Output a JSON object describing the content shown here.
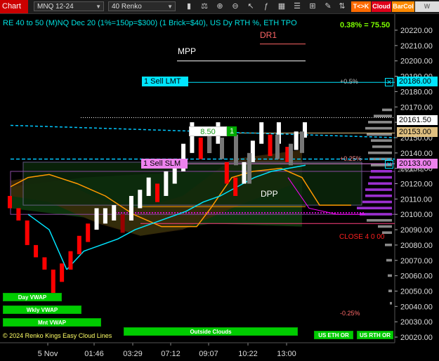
{
  "toolbar": {
    "chart_label": "Chart",
    "instrument": "MNQ 12-24",
    "bar_type": "40 Renko",
    "btn_tk": "T<>K",
    "btn_cloud": "Cloud",
    "btn_barcol": "BarCol",
    "btn_w": "W VWAP"
  },
  "header": {
    "title": "RE 40 to 50 (M)NQ Dec 20 (1%=150p=$300) (1 Brick=$40), US Dy RTH %, ETH TPO",
    "pct_change": "0.38% = 75.50"
  },
  "orders": {
    "sell_lmt": "1 Sell LMT",
    "sell_slm": "1 Sell SLM",
    "qty_price": "8.50",
    "qty": "1"
  },
  "levels": {
    "dr1": "DR1",
    "mpp": "MPP",
    "dpp": "DPP",
    "plus05": "+0.5%",
    "plus025": "+0.25%",
    "minus025": "-0.25%",
    "close": "CLOSE 4 0 00"
  },
  "price_labels": {
    "lmt": "20186.00",
    "last": "20161.50",
    "tan": "20153.00",
    "slm": "20133.00",
    "partial": "20129.72"
  },
  "buttons": {
    "day_vwap": "Day VWAP",
    "wkly_vwap": "Wkly VWAP",
    "mnt_vwap": "Mnt VWAP",
    "outside_clouds": "Outside Clouds",
    "us_eth_or": "US ETH OR",
    "us_rth_or": "US RTH OR"
  },
  "watermark": "© 2024 Renko Kings Easy Cloud Lines",
  "chart_data": {
    "type": "renko",
    "y_ticks": [
      20220,
      20210,
      20200,
      20190,
      20180,
      20170,
      20160,
      20150,
      20140,
      20130,
      20120,
      20110,
      20100,
      20090,
      20080,
      20070,
      20060,
      20050,
      20040,
      20030,
      20020
    ],
    "y_range": [
      20016,
      20228
    ],
    "x_labels": [
      "5 Nov",
      "01:46",
      "03:29",
      "07:12",
      "09:07",
      "10:22",
      "13:00"
    ],
    "bricks": [
      {
        "c": "down",
        "lo": 20104,
        "hi": 20112
      },
      {
        "c": "down",
        "lo": 20096,
        "hi": 20104
      },
      {
        "c": "down",
        "lo": 20080,
        "hi": 20096
      },
      {
        "c": "down",
        "lo": 20072,
        "hi": 20080
      },
      {
        "c": "down",
        "lo": 20064,
        "hi": 20072
      },
      {
        "c": "down",
        "lo": 20048,
        "hi": 20064
      },
      {
        "c": "down",
        "lo": 20056,
        "hi": 20068
      },
      {
        "c": "down",
        "lo": 20064,
        "hi": 20076
      },
      {
        "c": "down",
        "lo": 20074,
        "hi": 20086
      },
      {
        "c": "down",
        "lo": 20082,
        "hi": 20094
      },
      {
        "c": "up",
        "lo": 20090,
        "hi": 20104
      },
      {
        "c": "up",
        "lo": 20094,
        "hi": 20104
      },
      {
        "c": "up",
        "lo": 20096,
        "hi": 20106
      },
      {
        "c": "down",
        "lo": 20088,
        "hi": 20100
      },
      {
        "c": "up",
        "lo": 20096,
        "hi": 20112
      },
      {
        "c": "up",
        "lo": 20104,
        "hi": 20116
      },
      {
        "c": "up",
        "lo": 20112,
        "hi": 20124
      },
      {
        "c": "down",
        "lo": 20108,
        "hi": 20120
      },
      {
        "c": "up",
        "lo": 20112,
        "hi": 20128
      },
      {
        "c": "up",
        "lo": 20120,
        "hi": 20136
      },
      {
        "c": "up",
        "lo": 20128,
        "hi": 20146
      },
      {
        "c": "up",
        "lo": 20140,
        "hi": 20160
      },
      {
        "c": "down",
        "lo": 20136,
        "hi": 20150
      },
      {
        "c": "up",
        "lo": 20140,
        "hi": 20154
      },
      {
        "c": "up",
        "lo": 20146,
        "hi": 20160
      },
      {
        "c": "down",
        "lo": 20120,
        "hi": 20134
      },
      {
        "c": "down",
        "lo": 20112,
        "hi": 20124
      },
      {
        "c": "up",
        "lo": 20120,
        "hi": 20134
      },
      {
        "c": "up",
        "lo": 20134,
        "hi": 20148
      },
      {
        "c": "up",
        "lo": 20146,
        "hi": 20160
      },
      {
        "c": "down",
        "lo": 20138,
        "hi": 20152
      },
      {
        "c": "up",
        "lo": 20146,
        "hi": 20160
      },
      {
        "c": "down",
        "lo": 20134,
        "hi": 20144
      },
      {
        "c": "up",
        "lo": 20142,
        "hi": 20154
      },
      {
        "c": "up",
        "lo": 20150,
        "hi": 20160
      }
    ],
    "volume_profile": [
      {
        "p": 20168,
        "w": 14,
        "col": "gray"
      },
      {
        "p": 20164,
        "w": 26,
        "col": "gray"
      },
      {
        "p": 20160,
        "w": 34,
        "col": "gray"
      },
      {
        "p": 20156,
        "w": 38,
        "col": "gray"
      },
      {
        "p": 20152,
        "w": 36,
        "col": "gray"
      },
      {
        "p": 20148,
        "w": 30,
        "col": "gray"
      },
      {
        "p": 20144,
        "w": 28,
        "col": "gray"
      },
      {
        "p": 20140,
        "w": 34,
        "col": "gray"
      },
      {
        "p": 20136,
        "w": 32,
        "col": "gray"
      },
      {
        "p": 20132,
        "w": 30,
        "col": "gray"
      },
      {
        "p": 20128,
        "w": 30,
        "col": "purple"
      },
      {
        "p": 20124,
        "w": 32,
        "col": "purple"
      },
      {
        "p": 20120,
        "w": 34,
        "col": "purple"
      },
      {
        "p": 20116,
        "w": 38,
        "col": "purple"
      },
      {
        "p": 20112,
        "w": 38,
        "col": "purple"
      },
      {
        "p": 20108,
        "w": 42,
        "col": "purple"
      },
      {
        "p": 20104,
        "w": 50,
        "col": "purple"
      },
      {
        "p": 20100,
        "w": 46,
        "col": "purple"
      },
      {
        "p": 20096,
        "w": 36,
        "col": "gray"
      },
      {
        "p": 20092,
        "w": 20,
        "col": "gray"
      },
      {
        "p": 20088,
        "w": 14,
        "col": "gray"
      },
      {
        "p": 20080,
        "w": 10,
        "col": "gray"
      },
      {
        "p": 20070,
        "w": 8,
        "col": "gray"
      },
      {
        "p": 20060,
        "w": 6,
        "col": "gray"
      },
      {
        "p": 20050,
        "w": 5,
        "col": "gray"
      },
      {
        "p": 20042,
        "w": 3,
        "col": "gray"
      }
    ],
    "cyan_ma": [
      20064,
      20076,
      20080,
      20084,
      20090,
      20094,
      20098,
      20102,
      20108,
      20112,
      20118,
      20124,
      20128,
      20130,
      20132
    ],
    "colors": {
      "up": "#ffffff",
      "down": "#ff0000",
      "down_dark": "#990000",
      "cyan": "#00e5ff",
      "orange": "#ff9900",
      "magenta": "#ff00ff",
      "cloud_green": "#0f3d0f",
      "cloud_brown": "#3d2a0a"
    }
  }
}
